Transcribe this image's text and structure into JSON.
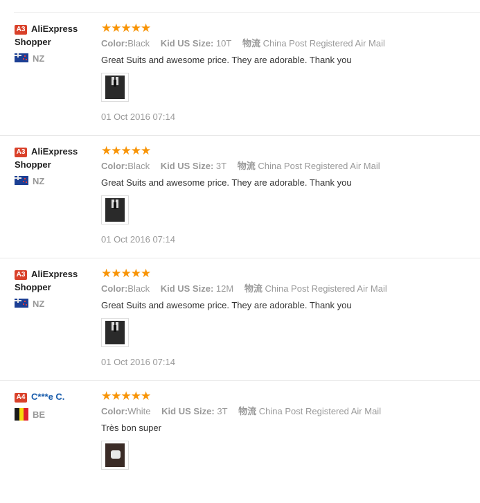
{
  "reviews": [
    {
      "badge": "A3",
      "name": "AliExpress Shopper",
      "country": "NZ",
      "stars": "★★★★★",
      "color_key": "Color:",
      "color_val": "Black",
      "size_key": "Kid US Size:",
      "size_val": "10T",
      "ship_key": "物流",
      "ship_val": "China Post Registered Air Mail",
      "text": "Great Suits and awesome price. They are adorable. Thank you",
      "date": "01 Oct 2016 07:14"
    },
    {
      "badge": "A3",
      "name": "AliExpress Shopper",
      "country": "NZ",
      "stars": "★★★★★",
      "color_key": "Color:",
      "color_val": "Black",
      "size_key": "Kid US Size:",
      "size_val": "3T",
      "ship_key": "物流",
      "ship_val": "China Post Registered Air Mail",
      "text": "Great Suits and awesome price. They are adorable. Thank you",
      "date": "01 Oct 2016 07:14"
    },
    {
      "badge": "A3",
      "name": "AliExpress Shopper",
      "country": "NZ",
      "stars": "★★★★★",
      "color_key": "Color:",
      "color_val": "Black",
      "size_key": "Kid US Size:",
      "size_val": "12M",
      "ship_key": "物流",
      "ship_val": "China Post Registered Air Mail",
      "text": "Great Suits and awesome price. They are adorable. Thank you",
      "date": "01 Oct 2016 07:14"
    },
    {
      "badge": "A4",
      "name": "C***e C.",
      "country": "BE",
      "stars": "★★★★★",
      "color_key": "Color:",
      "color_val": "White",
      "size_key": "Kid US Size:",
      "size_val": "3T",
      "ship_key": "物流",
      "ship_val": "China Post Registered Air Mail",
      "text": "Très bon super",
      "date": ""
    }
  ],
  "colors": {
    "star": "#f89406",
    "badge": "#d9412a",
    "link_name": "#1a5dac",
    "be_black": "#1a1a1a",
    "be_yellow": "#f5d90a",
    "be_red": "#e0202b"
  },
  "icons": [
    "nz-flag-icon",
    "be-flag-icon",
    "star-icon"
  ]
}
